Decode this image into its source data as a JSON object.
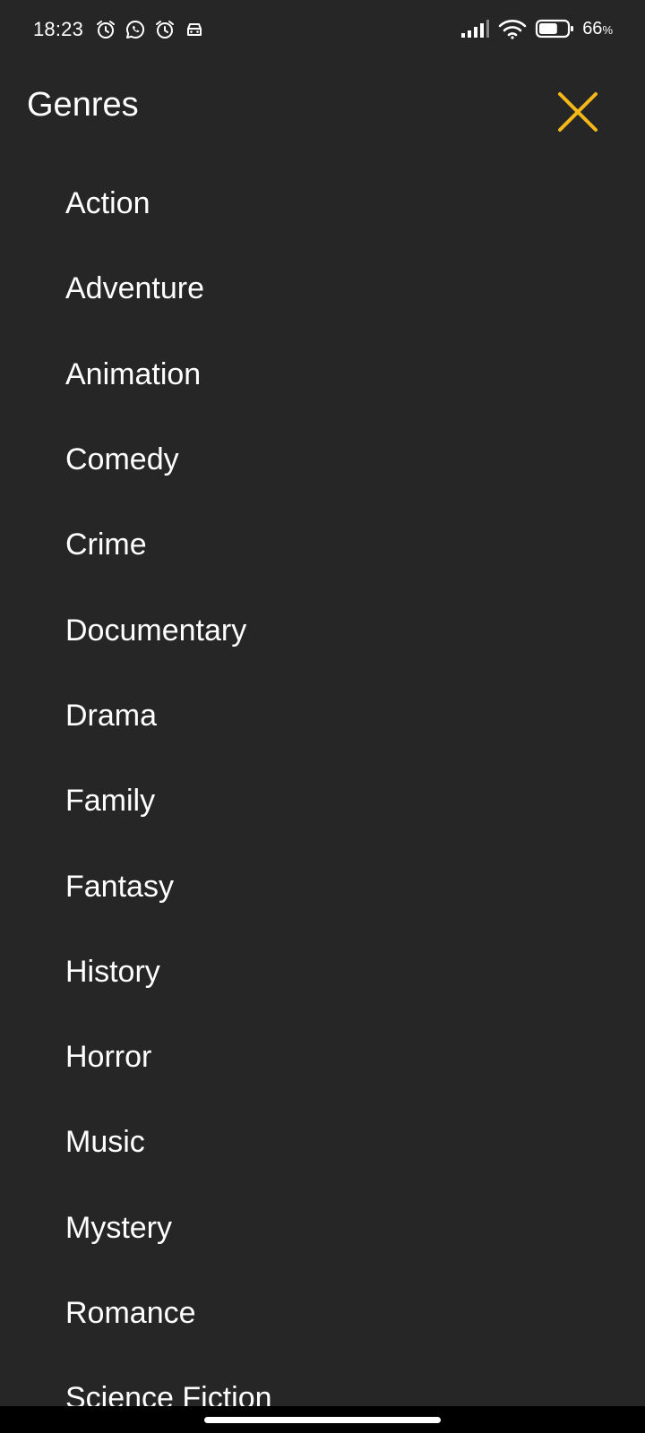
{
  "status_bar": {
    "time": "18:23",
    "left_icons": [
      "alarm-icon",
      "whatsapp-icon",
      "alarm-icon",
      "car-icon"
    ],
    "right_icons": [
      "signal-icon",
      "wifi-icon",
      "battery-icon"
    ],
    "battery_number": "66",
    "battery_unit": "%",
    "battery_level": 0.66
  },
  "header": {
    "title": "Genres",
    "close_icon": "close-icon"
  },
  "colors": {
    "background": "#262626",
    "text": "#ffffff",
    "accent": "#f5b818"
  },
  "genres": [
    {
      "label": "Action"
    },
    {
      "label": "Adventure"
    },
    {
      "label": "Animation"
    },
    {
      "label": "Comedy"
    },
    {
      "label": "Crime"
    },
    {
      "label": "Documentary"
    },
    {
      "label": "Drama"
    },
    {
      "label": "Family"
    },
    {
      "label": "Fantasy"
    },
    {
      "label": "History"
    },
    {
      "label": "Horror"
    },
    {
      "label": "Music"
    },
    {
      "label": "Mystery"
    },
    {
      "label": "Romance"
    },
    {
      "label": "Science Fiction"
    }
  ]
}
